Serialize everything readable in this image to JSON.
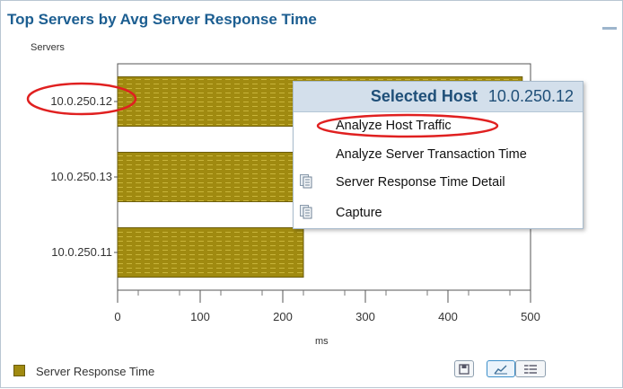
{
  "panel": {
    "title": "Top Servers by Avg Server Response Time",
    "legend_label": "Server Response Time"
  },
  "chart_data": {
    "type": "bar",
    "orientation": "horizontal",
    "ylabel": "Servers",
    "xlabel": "ms",
    "categories": [
      "10.0.250.12",
      "10.0.250.13",
      "10.0.250.11"
    ],
    "series": [
      {
        "name": "Server Response Time",
        "values": [
          490,
          435,
          225
        ]
      }
    ],
    "xlim": [
      0,
      500
    ],
    "xticks": [
      0,
      100,
      200,
      300,
      400,
      500
    ],
    "color": "#a08a10"
  },
  "context_menu": {
    "header_title": "Selected Host",
    "header_host": "10.0.250.12",
    "items": [
      {
        "label": "Analyze Host Traffic",
        "icon": "none"
      },
      {
        "label": "Analyze Server Transaction Time",
        "icon": "none"
      },
      {
        "label": "Server Response Time Detail",
        "icon": "document-icon"
      },
      {
        "label": "Capture",
        "icon": "document-icon"
      }
    ]
  },
  "toolbar": {
    "buttons": [
      {
        "icon": "save-icon"
      },
      {
        "icon": "chart-icon"
      },
      {
        "icon": "table-icon"
      }
    ]
  },
  "colors": {
    "title": "#1c5e91",
    "bar": "#a08a10",
    "highlight_ellipse": "#e02020"
  }
}
